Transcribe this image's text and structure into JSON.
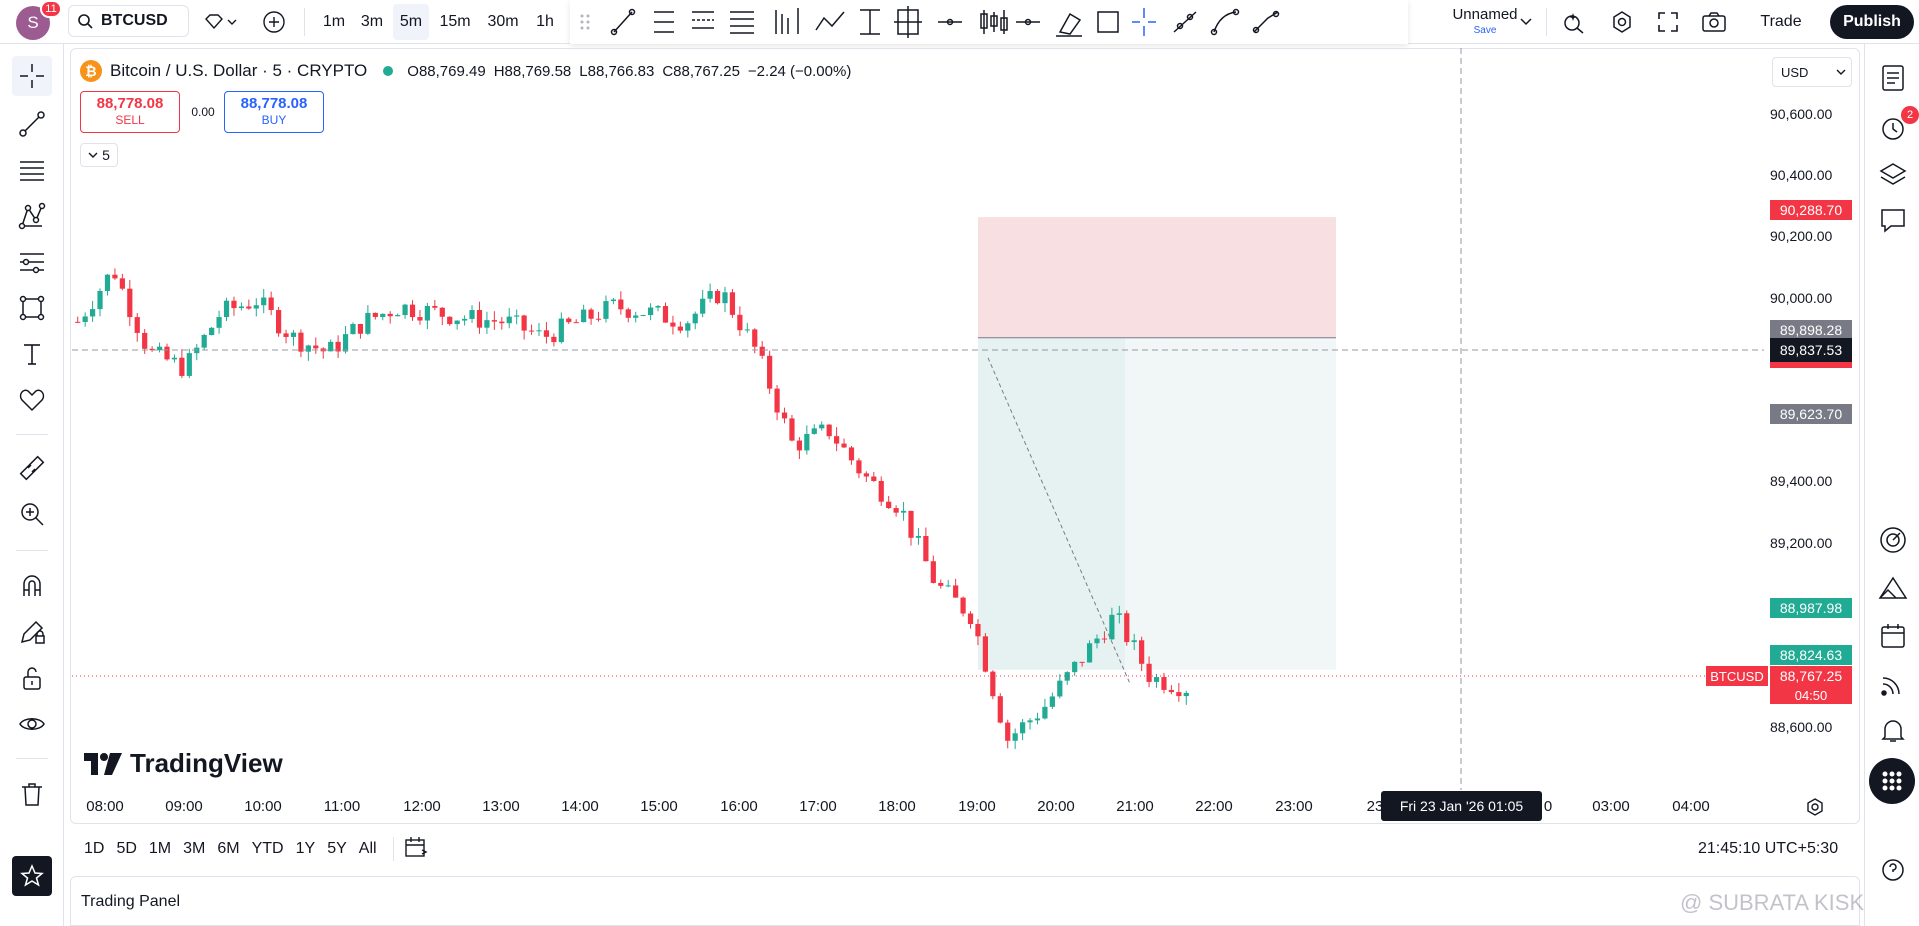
{
  "header": {
    "user_initial": "S",
    "notifications": "11",
    "symbol": "BTCUSD",
    "intervals": [
      "1m",
      "3m",
      "5m",
      "15m",
      "30m",
      "1h"
    ],
    "active_interval": "5m",
    "layout_name": "Unnamed",
    "layout_save": "Save",
    "trade_label": "Trade",
    "publish_label": "Publish"
  },
  "legend": {
    "title": "Bitcoin / U.S. Dollar · 5 · CRYPTO",
    "open": "O88,769.49",
    "high": "H88,769.58",
    "low": "L88,766.83",
    "close": "C88,767.25",
    "change": "−2.24 (−0.00%)"
  },
  "order": {
    "sell_price": "88,778.08",
    "sell_label": "SELL",
    "spread": "0.00",
    "buy_price": "88,778.08",
    "buy_label": "BUY",
    "indicator_count": "5"
  },
  "price_axis": {
    "currency": "USD",
    "ticks": [
      "90,600.00",
      "90,400.00",
      "90,200.00",
      "90,000.00",
      "89,400.00",
      "89,200.00",
      "88,600.00"
    ],
    "badges": {
      "stop": "90,288.70",
      "entry": "89,898.28",
      "crosshair": "89,837.53",
      "grey2": "89,623.70",
      "target": "88,987.98",
      "g2": "88,824.63",
      "symbol_tag": "BTCUSD",
      "last": "88,767.25",
      "countdown": "04:50"
    },
    "colors": {
      "up": "#22ab94",
      "down": "#f23645",
      "stop_zone": "#f8dfe1",
      "target_zone": "#e6f2f1"
    }
  },
  "time_axis": {
    "labels": [
      "08:00",
      "09:00",
      "10:00",
      "11:00",
      "12:00",
      "13:00",
      "14:00",
      "15:00",
      "16:00",
      "17:00",
      "18:00",
      "19:00",
      "20:00",
      "21:00",
      "22:00",
      "23:00",
      "23",
      "0",
      "03:00",
      "04:00"
    ],
    "crosshair": "Fri 23 Jan '26   01:05"
  },
  "bottom": {
    "ranges": [
      "1D",
      "5D",
      "1M",
      "3M",
      "6M",
      "YTD",
      "1Y",
      "5Y",
      "All"
    ],
    "clock": "21:45:10 UTC+5:30",
    "panel_title": "Trading Panel",
    "watermark_brand": "TradingView",
    "credit": "@ SUBRATA KISKU"
  },
  "right_sidebar": {
    "alerts_badge": "2"
  },
  "chart_data": {
    "type": "candlestick",
    "x": [
      "08:00",
      "09:00",
      "10:00",
      "11:00",
      "12:00",
      "13:00",
      "14:00",
      "15:00",
      "16:00",
      "17:00",
      "18:00",
      "19:00",
      "20:00",
      "21:00",
      "22:00",
      "23:00"
    ],
    "close_path": [
      89950,
      90120,
      89850,
      89800,
      89980,
      90020,
      89900,
      89850,
      89950,
      90000,
      89980,
      89960,
      89950,
      89900,
      89950,
      90000,
      89980,
      89950,
      90050,
      89850,
      89550,
      89600,
      89450,
      89350,
      89100,
      89000,
      88600,
      88700,
      88850,
      89000,
      88800,
      88767
    ],
    "ylim": [
      88500,
      90700
    ],
    "position": {
      "stop": 90288.7,
      "entry": 89898.28,
      "target": 88824.63
    }
  }
}
